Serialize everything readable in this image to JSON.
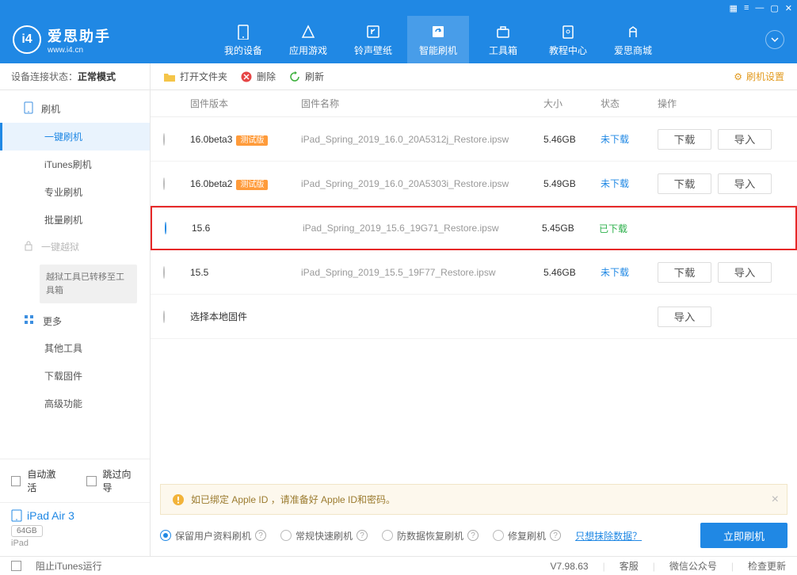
{
  "titlebar": {
    "icons": [
      "grid",
      "menu",
      "min",
      "max",
      "close"
    ]
  },
  "header": {
    "title": "爱思助手",
    "url": "www.i4.cn",
    "nav": [
      {
        "label": "我的设备"
      },
      {
        "label": "应用游戏"
      },
      {
        "label": "铃声壁纸"
      },
      {
        "label": "智能刷机",
        "active": true
      },
      {
        "label": "工具箱"
      },
      {
        "label": "教程中心"
      },
      {
        "label": "爱思商城"
      }
    ]
  },
  "sidebar": {
    "status_label": "设备连接状态：",
    "status_value": "正常模式",
    "groups": [
      {
        "label": "刷机",
        "icon": "phone",
        "children": [
          {
            "label": "一键刷机",
            "active": true
          },
          {
            "label": "iTunes刷机"
          },
          {
            "label": "专业刷机"
          },
          {
            "label": "批量刷机"
          }
        ]
      },
      {
        "label": "一键越狱",
        "icon": "lock",
        "disabled": true,
        "info": "越狱工具已转移至工具箱"
      },
      {
        "label": "更多",
        "icon": "more",
        "children": [
          {
            "label": "其他工具"
          },
          {
            "label": "下载固件"
          },
          {
            "label": "高级功能"
          }
        ]
      }
    ],
    "auto_activate": "自动激活",
    "skip_guide": "跳过向导",
    "device": {
      "name": "iPad Air 3",
      "capacity": "64GB",
      "type": "iPad"
    }
  },
  "toolbar": {
    "open": "打开文件夹",
    "delete": "删除",
    "refresh": "刷新",
    "settings": "刷机设置"
  },
  "table": {
    "head": {
      "ver": "固件版本",
      "name": "固件名称",
      "size": "大小",
      "status": "状态",
      "ops": "操作"
    },
    "download": "下载",
    "import": "导入",
    "rows": [
      {
        "ver": "16.0beta3",
        "badge": "测试版",
        "name": "iPad_Spring_2019_16.0_20A5312j_Restore.ipsw",
        "size": "5.46GB",
        "status": "未下载",
        "status_cls": "not",
        "ops": [
          "download",
          "import"
        ]
      },
      {
        "ver": "16.0beta2",
        "badge": "测试版",
        "name": "iPad_Spring_2019_16.0_20A5303i_Restore.ipsw",
        "size": "5.49GB",
        "status": "未下载",
        "status_cls": "not",
        "ops": [
          "download",
          "import"
        ]
      },
      {
        "ver": "15.6",
        "name": "iPad_Spring_2019_15.6_19G71_Restore.ipsw",
        "size": "5.45GB",
        "status": "已下载",
        "status_cls": "done",
        "selected": true,
        "highlight": true
      },
      {
        "ver": "15.5",
        "name": "iPad_Spring_2019_15.5_19F77_Restore.ipsw",
        "size": "5.46GB",
        "status": "未下载",
        "status_cls": "not",
        "ops": [
          "download",
          "import"
        ]
      },
      {
        "ver_text": "选择本地固件",
        "local": true,
        "ops": [
          "import"
        ]
      }
    ]
  },
  "notice": "如已绑定 Apple ID ，请准备好 Apple ID和密码。",
  "flash": {
    "opts": [
      "保留用户资料刷机",
      "常规快速刷机",
      "防数据恢复刷机",
      "修复刷机"
    ],
    "selected": 0,
    "link": "只想抹除数据？",
    "go": "立即刷机"
  },
  "footer": {
    "block_itunes": "阻止iTunes运行",
    "version": "V7.98.63",
    "items": [
      "客服",
      "微信公众号",
      "检查更新"
    ]
  }
}
